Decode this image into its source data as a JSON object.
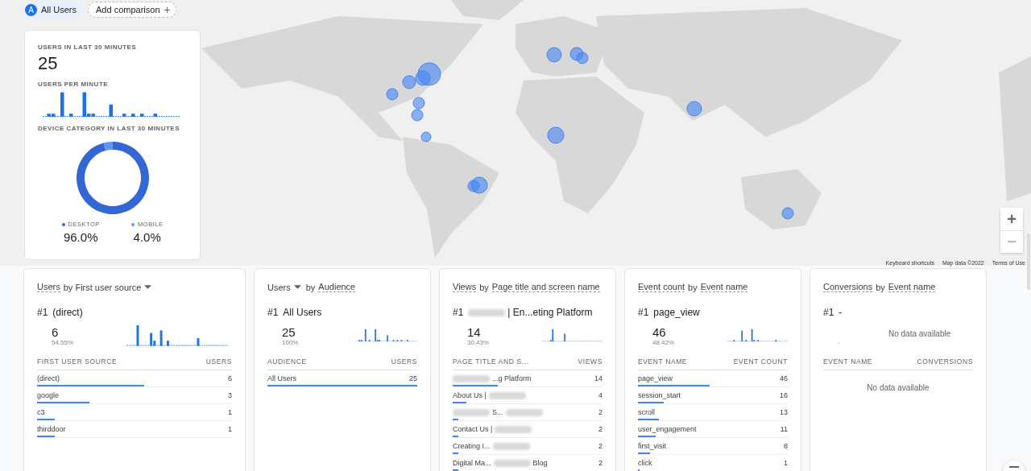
{
  "comparison_bar": {
    "chips": [
      {
        "kind": "segment",
        "avatar": "A",
        "label": "All Users"
      },
      {
        "kind": "add",
        "label": "Add comparison",
        "icon": "+"
      }
    ]
  },
  "map": {
    "zoom_controls": [
      "+",
      "−"
    ],
    "attribution": [
      "Keyboard shortcuts",
      "Map data ©2022",
      "Terms of Use"
    ]
  },
  "overview_card": {
    "users_title": "USERS IN LAST 30 MINUTES",
    "users_value": "25",
    "per_minute_title": "USERS PER MINUTE",
    "device_title": "DEVICE CATEGORY IN LAST 30 MINUTES",
    "chart_data": {
      "type": "donut",
      "categories": [
        "DESKTOP",
        "MOBILE"
      ],
      "values": [
        96,
        4
      ]
    },
    "legend": [
      {
        "value": "96.0%",
        "color": "#3367d6"
      },
      {
        "value": "4.0%",
        "color": "#5e97f6"
      }
    ]
  },
  "cards": [
    {
      "title": [
        {
          "kind": "underlined",
          "text": "Users"
        },
        {
          "kind": "plain",
          "text": "by First user source"
        },
        {
          "kind": "caret"
        }
      ],
      "top": {
        "rank": "#1",
        "label": [
          {
            "kind": "text",
            "text": "(direct)"
          }
        ],
        "value": "6",
        "share": "54.55%"
      },
      "table": {
        "columns": [
          "FIRST USER SOURCE",
          "USERS"
        ],
        "rows": [
          {
            "label": [
              {
                "kind": "text",
                "text": "(direct)"
              }
            ],
            "value": "6",
            "level": 0.55
          },
          {
            "label": [
              {
                "kind": "text",
                "text": "google"
              }
            ],
            "value": "3",
            "level": 0.27
          },
          {
            "label": [
              {
                "kind": "text",
                "text": "c3"
              }
            ],
            "value": "1",
            "level": 0.09
          },
          {
            "label": [
              {
                "kind": "text",
                "text": "thirddoor"
              }
            ],
            "value": "1",
            "level": 0.09
          }
        ]
      }
    },
    {
      "title": [
        {
          "kind": "plain",
          "text": "Users"
        },
        {
          "kind": "caret"
        },
        {
          "kind": "plain",
          "text": "by"
        },
        {
          "kind": "underlined",
          "text": "Audience"
        }
      ],
      "top": {
        "rank": "#1",
        "label": [
          {
            "kind": "text",
            "text": "All Users"
          }
        ],
        "value": "25",
        "share": "100%"
      },
      "table": {
        "columns": [
          "AUDIENCE",
          "USERS"
        ],
        "rows": [
          {
            "label": [
              {
                "kind": "text",
                "text": "All Users"
              }
            ],
            "value": "25",
            "level": 1
          }
        ]
      }
    },
    {
      "title": [
        {
          "kind": "underlined",
          "text": "Views"
        },
        {
          "kind": "plain",
          "text": "by"
        },
        {
          "kind": "underlined",
          "text": "Page title and screen name"
        }
      ],
      "top": {
        "rank": "#1",
        "label": [
          {
            "kind": "blur"
          },
          {
            "kind": "text",
            "text": "| En...eting Platform"
          }
        ],
        "value": "14",
        "share": "30.43%"
      },
      "table": {
        "columns": [
          "PAGE TITLE AND S...",
          "VIEWS"
        ],
        "rows": [
          {
            "label": [
              {
                "kind": "blur"
              },
              {
                "kind": "text",
                "text": "...g Platform"
              }
            ],
            "value": "14",
            "level": 0.3
          },
          {
            "label": [
              {
                "kind": "text",
                "text": "About Us |"
              },
              {
                "kind": "blur"
              }
            ],
            "value": "4",
            "level": 0.09
          },
          {
            "label": [
              {
                "kind": "blur"
              },
              {
                "kind": "text",
                "text": "S..."
              },
              {
                "kind": "blur"
              }
            ],
            "value": "2",
            "level": 0.04
          },
          {
            "label": [
              {
                "kind": "text",
                "text": "Contact Us |"
              },
              {
                "kind": "blur"
              }
            ],
            "value": "2",
            "level": 0.04
          },
          {
            "label": [
              {
                "kind": "text",
                "text": "Creating I..."
              },
              {
                "kind": "blur"
              }
            ],
            "value": "2",
            "level": 0.04
          },
          {
            "label": [
              {
                "kind": "text",
                "text": "Digital Ma..."
              },
              {
                "kind": "blur"
              },
              {
                "kind": "text",
                "text": "Blog"
              }
            ],
            "value": "2",
            "level": 0.04
          }
        ]
      }
    },
    {
      "title": [
        {
          "kind": "underlined",
          "text": "Event count"
        },
        {
          "kind": "plain",
          "text": "by"
        },
        {
          "kind": "underlined",
          "text": "Event name"
        }
      ],
      "top": {
        "rank": "#1",
        "label": [
          {
            "kind": "text",
            "text": "page_view"
          }
        ],
        "value": "46",
        "share": "48.42%"
      },
      "table": {
        "columns": [
          "EVENT NAME",
          "EVENT COUNT"
        ],
        "rows": [
          {
            "label": [
              {
                "kind": "text",
                "text": "page_view"
              }
            ],
            "value": "46",
            "level": 0.48
          },
          {
            "label": [
              {
                "kind": "text",
                "text": "session_start"
              }
            ],
            "value": "16",
            "level": 0.17
          },
          {
            "label": [
              {
                "kind": "text",
                "text": "scroll"
              }
            ],
            "value": "13",
            "level": 0.14
          },
          {
            "label": [
              {
                "kind": "text",
                "text": "user_engagement"
              }
            ],
            "value": "11",
            "level": 0.12
          },
          {
            "label": [
              {
                "kind": "text",
                "text": "first_visit"
              }
            ],
            "value": "8",
            "level": 0.08
          },
          {
            "label": [
              {
                "kind": "text",
                "text": "click"
              }
            ],
            "value": "1",
            "level": 0.01
          }
        ]
      }
    },
    {
      "title": [
        {
          "kind": "underlined",
          "text": "Conversions"
        },
        {
          "kind": "plain",
          "text": "by"
        },
        {
          "kind": "underlined",
          "text": "Event name"
        }
      ],
      "top": {
        "rank": "#1",
        "label": [
          {
            "kind": "text",
            "text": "-"
          }
        ],
        "value": "-",
        "empty_message": "No data available"
      },
      "table": {
        "columns": [
          "EVENT NAME",
          "CONVERSIONS"
        ],
        "empty_message": "No data available"
      }
    }
  ]
}
